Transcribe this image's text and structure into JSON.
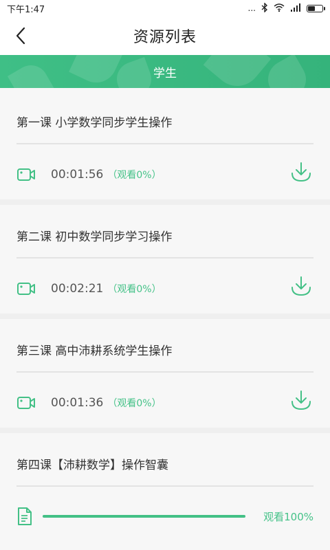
{
  "status": {
    "time": "下午1:47",
    "dots": "...",
    "bluetooth": "✱",
    "wifi": "wifi",
    "signal": "signal"
  },
  "header": {
    "title": "资源列表",
    "back_icon": "chevron-left-icon"
  },
  "tab": {
    "label": "学生"
  },
  "colors": {
    "accent": "#3fbf86",
    "text": "#333333"
  },
  "items": [
    {
      "title": "第一课 小学数学同步学生操作",
      "duration": "00:01:56",
      "progress": "（观看0%）"
    },
    {
      "title": "第二课 初中数学同步学习操作",
      "duration": "00:02:21",
      "progress": "（观看0%）"
    },
    {
      "title": "第三课 高中沛耕系统学生操作",
      "duration": "00:01:36",
      "progress": "（观看0%）"
    }
  ],
  "doc_item": {
    "title": "第四课【沛耕数学】操作智囊",
    "progress_fraction": 1.0,
    "watch_label": "观看100%"
  }
}
